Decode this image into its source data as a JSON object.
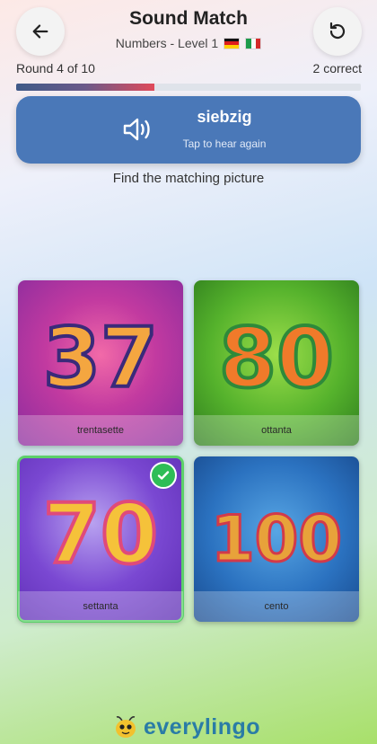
{
  "header": {
    "title": "Sound Match",
    "subtitle": "Numbers - Level 1",
    "back_icon": "arrow-left-icon",
    "restart_icon": "restart-icon"
  },
  "progress": {
    "round_text": "Round 4 of 10",
    "correct_text": "2 correct",
    "fraction": 0.4
  },
  "audio": {
    "word": "siebzig",
    "hint": "Tap to hear again",
    "icon": "speaker-icon"
  },
  "instruction": "Find the matching picture",
  "cards": [
    {
      "number": "37",
      "label": "trentasette",
      "selected": false
    },
    {
      "number": "80",
      "label": "ottanta",
      "selected": false
    },
    {
      "number": "70",
      "label": "settanta",
      "selected": true
    },
    {
      "number": "100",
      "label": "cento",
      "selected": false
    }
  ],
  "brand": {
    "name": "everylingo",
    "icon": "bee-icon"
  },
  "colors": {
    "audio_card": "#4a78b8",
    "check": "#2ebd57",
    "brand": "#2a7ca6"
  }
}
